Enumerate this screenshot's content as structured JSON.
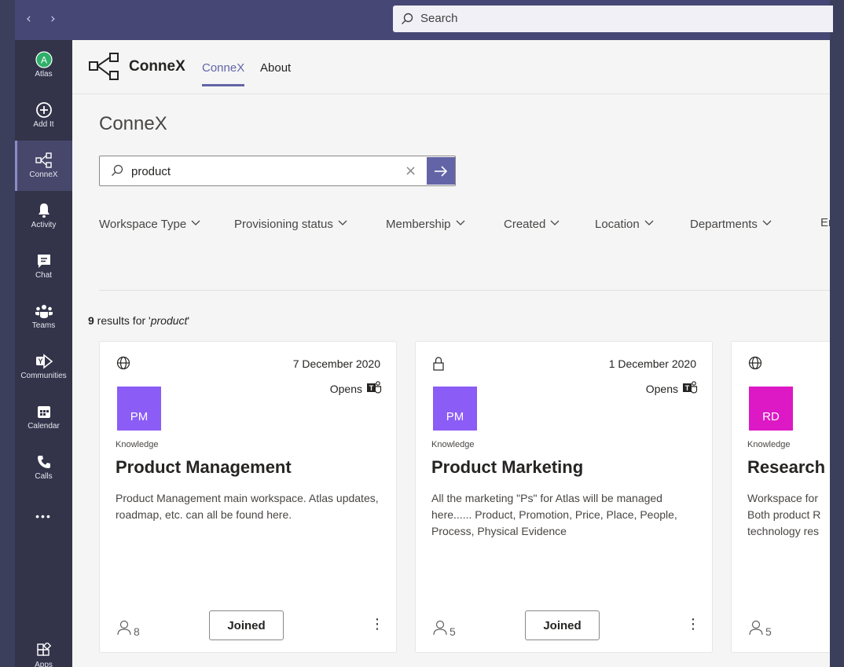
{
  "titlebar": {
    "back_glyph": "‹",
    "forward_glyph": "›",
    "search_placeholder": "Search"
  },
  "rail": {
    "items": [
      {
        "label": "Atlas",
        "icon": "atlas-avatar-icon",
        "badge": "A"
      },
      {
        "label": "Add It",
        "icon": "add-circle-icon"
      },
      {
        "label": "ConneX",
        "icon": "connex-icon",
        "active": true
      },
      {
        "label": "Activity",
        "icon": "bell-icon"
      },
      {
        "label": "Chat",
        "icon": "chat-icon"
      },
      {
        "label": "Teams",
        "icon": "teams-icon"
      },
      {
        "label": "Communities",
        "icon": "communities-icon"
      },
      {
        "label": "Calendar",
        "icon": "calendar-icon"
      },
      {
        "label": "Calls",
        "icon": "phone-icon"
      },
      {
        "label": "",
        "icon": "more-icon",
        "glyph": "•••"
      },
      {
        "label": "Apps",
        "icon": "apps-icon"
      }
    ]
  },
  "app": {
    "name": "ConneX",
    "tabs": [
      {
        "label": "ConneX",
        "active": true
      },
      {
        "label": "About",
        "active": false
      }
    ]
  },
  "page": {
    "title": "ConneX",
    "query": "product",
    "clear_glyph": "×",
    "filters": [
      "Workspace Type",
      "Provisioning status",
      "Membership",
      "Created",
      "Location",
      "Departments",
      "Enti"
    ],
    "results": {
      "count": "9",
      "text_before": " results for '",
      "term": "product",
      "text_after": "'"
    }
  },
  "cards": [
    {
      "visibility": "globe-icon",
      "date": "7 December 2020",
      "opens_label": "Opens",
      "initials": "PM",
      "avatar_color": "#8b5cf6",
      "type": "Knowledge",
      "title": "Product Management",
      "description": "Product Management main workspace. Atlas updates, roadmap, etc. can all be found here.",
      "members": "8",
      "action_label": "Joined",
      "more_glyph": "⋮"
    },
    {
      "visibility": "lock-icon",
      "date": "1 December 2020",
      "opens_label": "Opens",
      "initials": "PM",
      "avatar_color": "#8b5cf6",
      "type": "Knowledge",
      "title": "Product Marketing",
      "description": "All the marketing \"Ps\" for Atlas will be managed here...... Product, Promotion, Price, Place, People, Process, Physical Evidence",
      "members": "5",
      "action_label": "Joined",
      "more_glyph": "⋮"
    },
    {
      "visibility": "globe-icon",
      "date": "",
      "opens_label": "",
      "initials": "RD",
      "avatar_color": "#dd18c5",
      "type": "Knowledge",
      "title": "Research &",
      "description": "Workspace for Both product R technology res",
      "members": "5",
      "action_label": "",
      "more_glyph": ""
    }
  ]
}
